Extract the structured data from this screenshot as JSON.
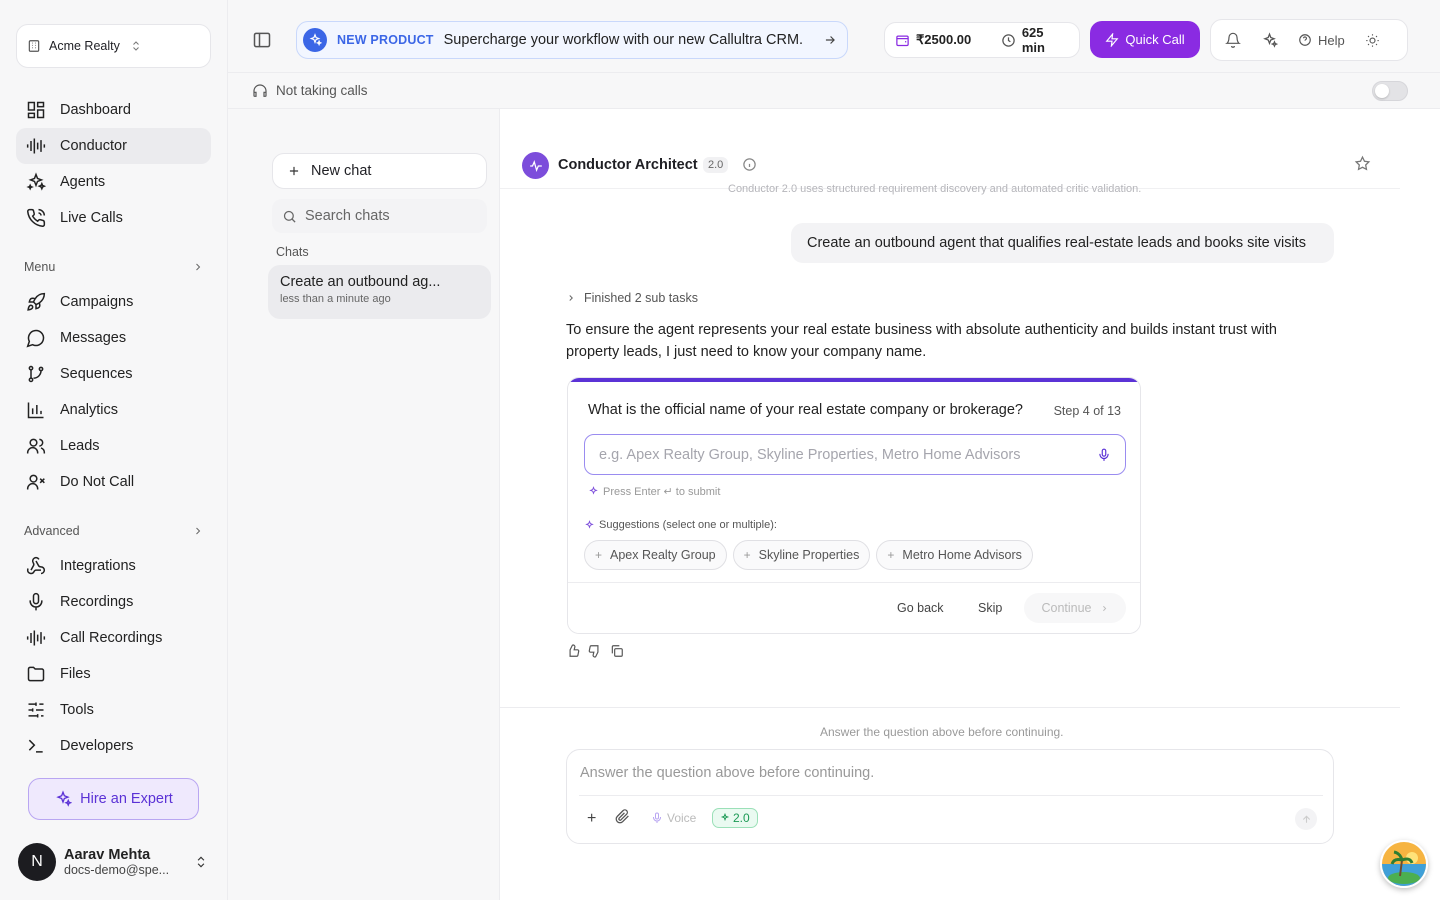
{
  "org": {
    "name": "Acme Realty"
  },
  "nav_primary": [
    {
      "label": "Dashboard",
      "icon": "dashboard-icon"
    },
    {
      "label": "Conductor",
      "icon": "waveform-icon",
      "active": true
    },
    {
      "label": "Agents",
      "icon": "sparkles-icon"
    },
    {
      "label": "Live Calls",
      "icon": "phone-call-icon"
    }
  ],
  "menu_section": {
    "label": "Menu"
  },
  "nav_menu": [
    {
      "label": "Campaigns",
      "icon": "rocket-icon"
    },
    {
      "label": "Messages",
      "icon": "message-circle-icon"
    },
    {
      "label": "Sequences",
      "icon": "git-branch-icon"
    },
    {
      "label": "Analytics",
      "icon": "bar-chart-icon"
    },
    {
      "label": "Leads",
      "icon": "users-icon"
    },
    {
      "label": "Do Not Call",
      "icon": "user-x-icon"
    }
  ],
  "advanced_section": {
    "label": "Advanced"
  },
  "nav_advanced": [
    {
      "label": "Integrations",
      "icon": "webhook-icon"
    },
    {
      "label": "Recordings",
      "icon": "mic-icon"
    },
    {
      "label": "Call Recordings",
      "icon": "audio-lines-icon"
    },
    {
      "label": "Files",
      "icon": "folder-icon"
    },
    {
      "label": "Tools",
      "icon": "sliders-icon"
    },
    {
      "label": "Developers",
      "icon": "terminal-icon"
    }
  ],
  "hire": {
    "label": "Hire an Expert"
  },
  "user": {
    "initial": "N",
    "name": "Aarav Mehta",
    "email": "docs-demo@spe..."
  },
  "promo": {
    "tag": "NEW PRODUCT",
    "message": "Supercharge your workflow with our new Callultra CRM."
  },
  "wallet": {
    "balance": "₹2500.00",
    "minutes": "625 min"
  },
  "quick_call": {
    "label": "Quick Call"
  },
  "help": {
    "label": "Help"
  },
  "status": {
    "text": "Not taking calls",
    "toggle_on": false
  },
  "chatlist": {
    "new_chat": "New chat",
    "search_placeholder": "Search chats",
    "heading": "Chats",
    "items": [
      {
        "title": "Create an outbound ag...",
        "time": "less than a minute ago"
      }
    ]
  },
  "conversation": {
    "title": "Conductor Architect",
    "version": "2.0",
    "faded_text": "Conductor 2.0 uses structured requirement discovery and automated critic validation.",
    "user_message": "Create an outbound agent that qualifies real-estate leads and books site visits",
    "finished": "Finished 2 sub tasks",
    "assistant_message": "To ensure the agent represents your real estate business with absolute authenticity and builds instant trust with property leads, I just need to know your company name."
  },
  "question": {
    "text": "What is the official name of your real estate company or brokerage?",
    "step": "Step 4 of 13",
    "placeholder": "e.g. Apex Realty Group, Skyline Properties, Metro Home Advisors",
    "press_hint": "Press Enter ↵ to submit",
    "suggestions_label": "Suggestions (select one or multiple):",
    "suggestions": [
      "Apex Realty Group",
      "Skyline Properties",
      "Metro Home Advisors"
    ],
    "go_back": "Go back",
    "skip": "Skip",
    "continue": "Continue"
  },
  "composer": {
    "hint": "Answer the question above before continuing.",
    "placeholder": "Answer the question above before continuing.",
    "voice": "Voice",
    "version": "2.0"
  },
  "colors": {
    "accent": "#8a2be2",
    "brand_purple": "#5b32d6",
    "promo_blue": "#3b66e6",
    "version_green": "#1c9a55"
  }
}
